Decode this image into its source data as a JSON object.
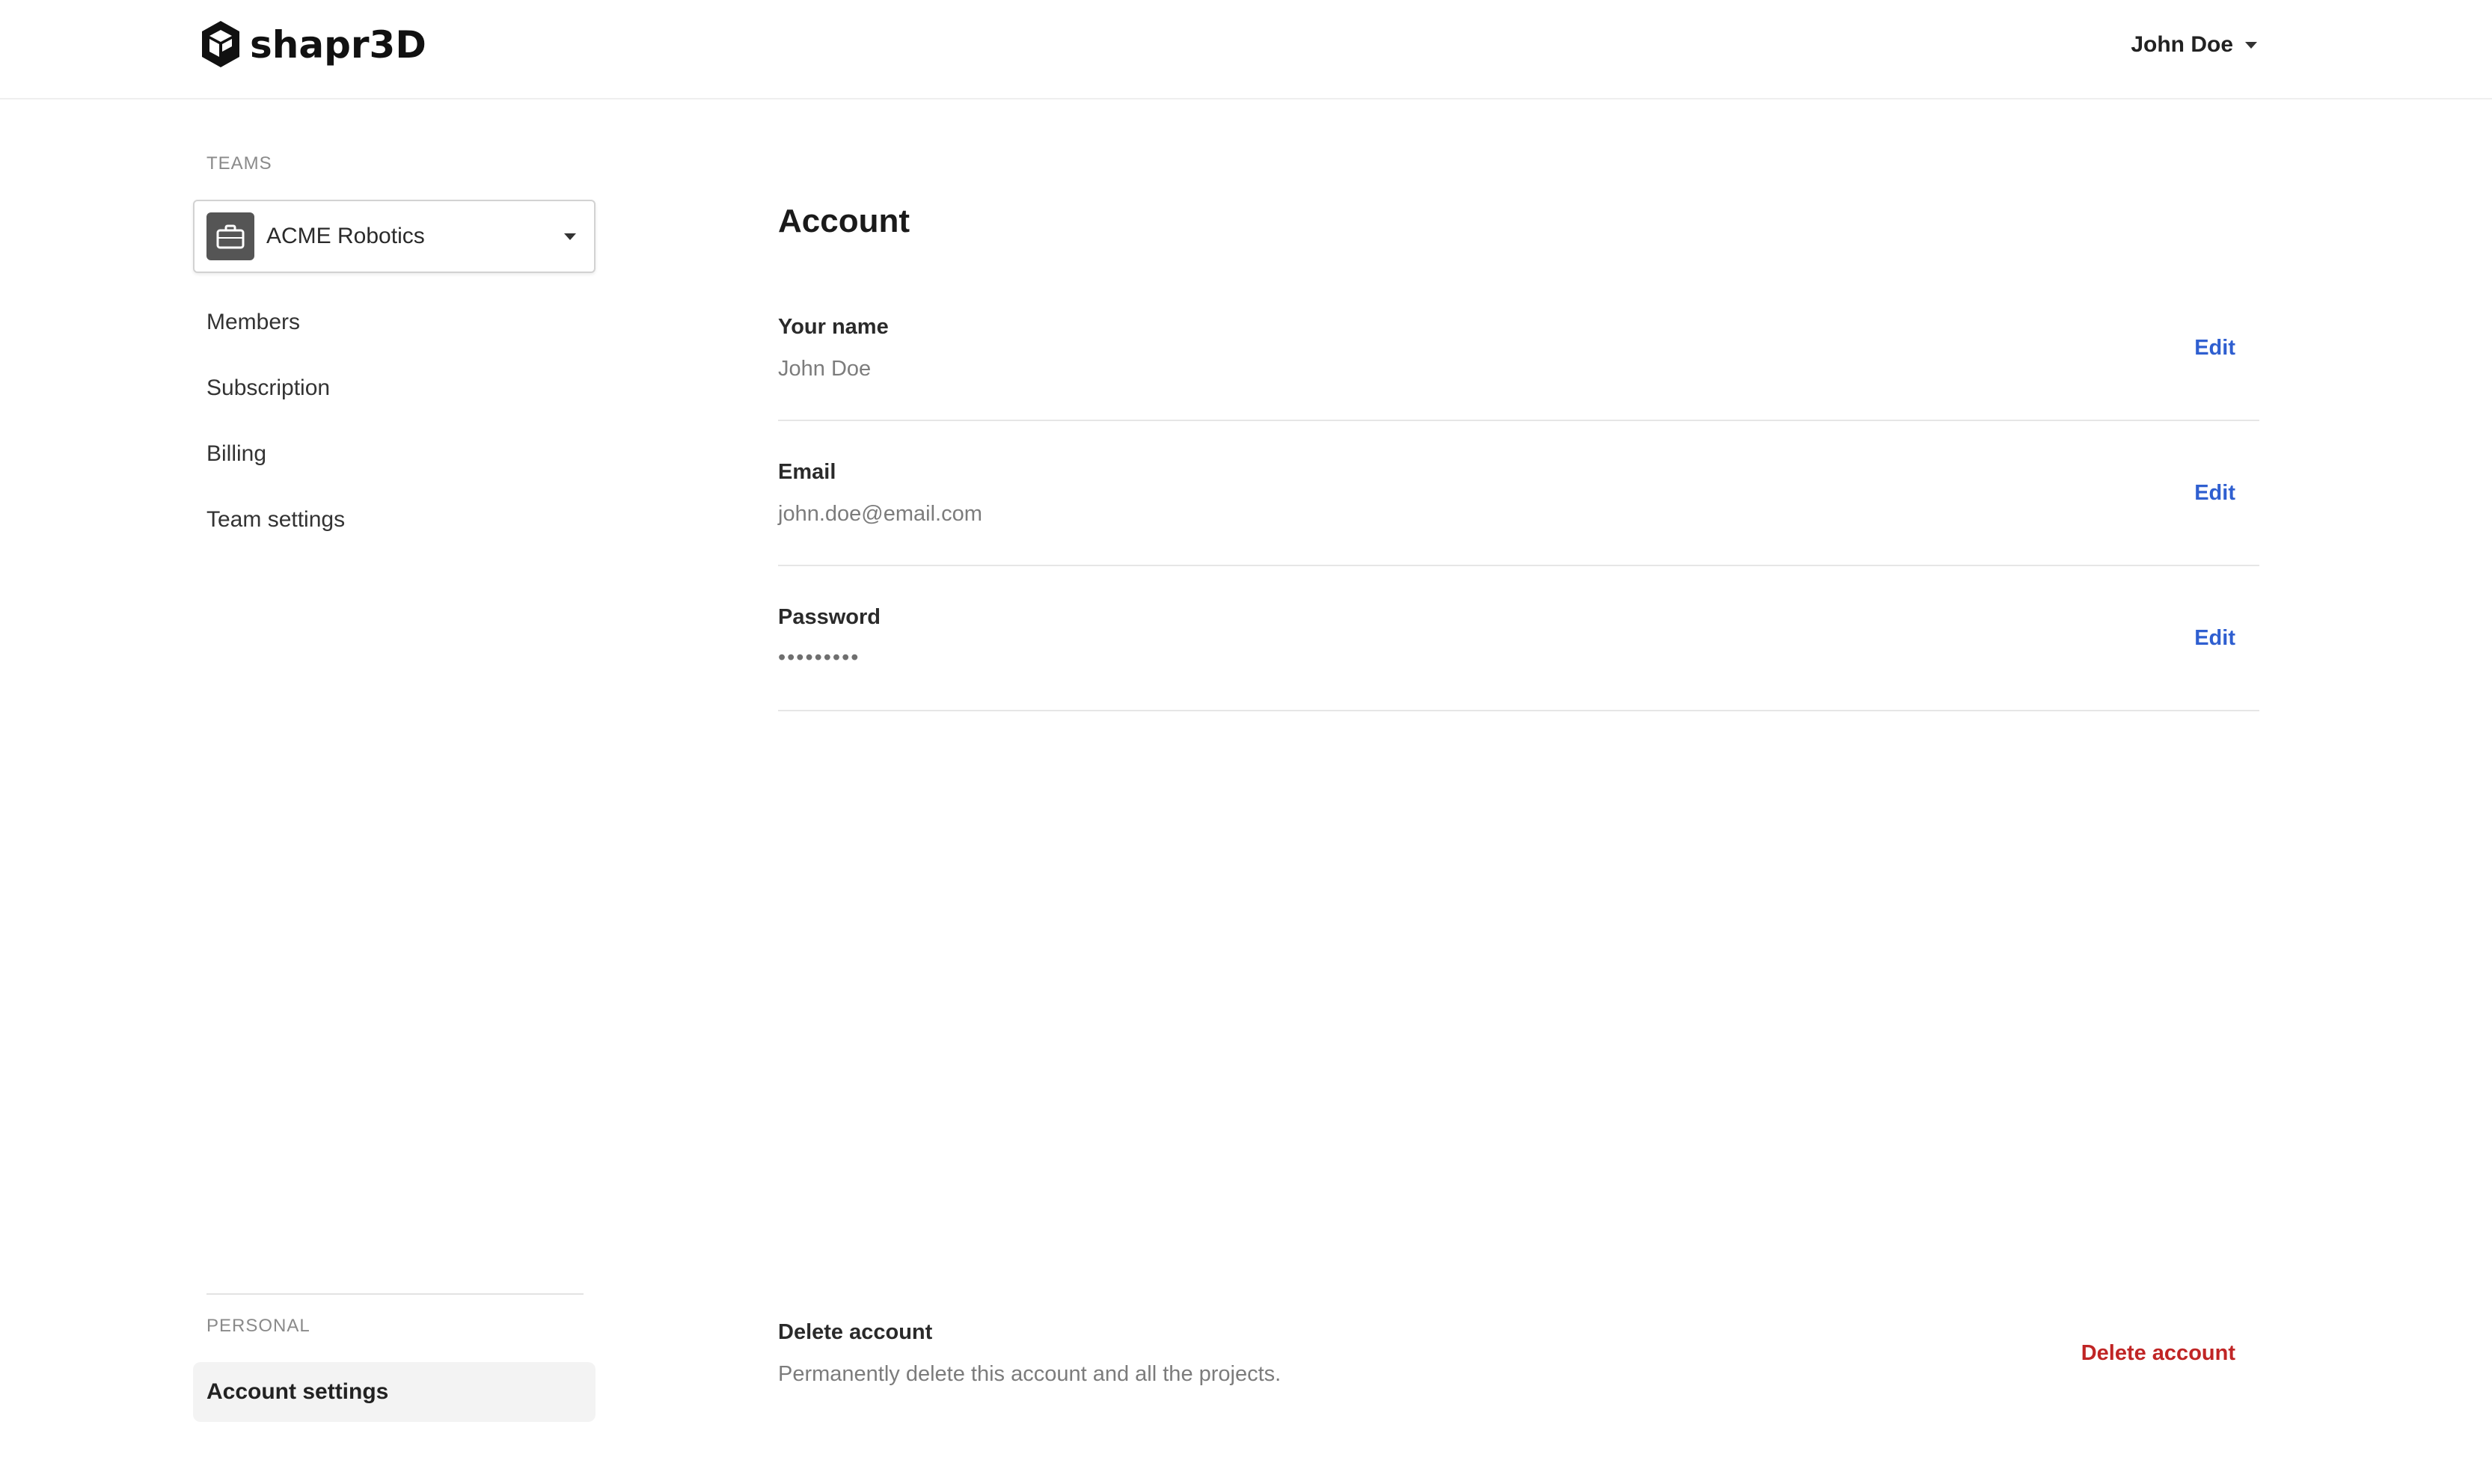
{
  "header": {
    "brand": "shapr3D",
    "user_name": "John Doe"
  },
  "sidebar": {
    "teams_label": "TEAMS",
    "team_selected": "ACME Robotics",
    "items": [
      {
        "label": "Members"
      },
      {
        "label": "Subscription"
      },
      {
        "label": "Billing"
      },
      {
        "label": "Team settings"
      }
    ],
    "personal_label": "PERSONAL",
    "active_item": "Account settings"
  },
  "main": {
    "title": "Account",
    "fields": [
      {
        "label": "Your name",
        "value": "John Doe",
        "action": "Edit"
      },
      {
        "label": "Email",
        "value": "john.doe@email.com",
        "action": "Edit"
      },
      {
        "label": "Password",
        "value": "•••••••••",
        "action": "Edit"
      }
    ],
    "delete": {
      "label": "Delete account",
      "description": "Permanently delete this account and all the projects.",
      "action": "Delete account"
    }
  },
  "colors": {
    "link": "#2f5fd0",
    "danger": "#c02525",
    "muted": "#7c7c7c"
  }
}
